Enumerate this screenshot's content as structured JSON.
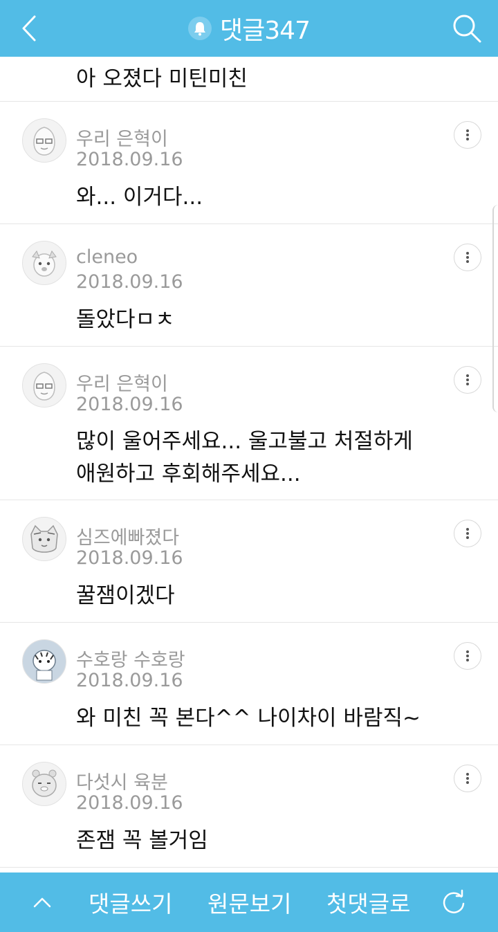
{
  "header": {
    "title": "댓글347",
    "back_icon": "chevron-left-icon",
    "bell_icon": "bell-icon",
    "search_icon": "search-icon"
  },
  "colors": {
    "accent": "#52bce6",
    "meta_text": "#9a9a9a",
    "body_text": "#111111"
  },
  "first_comment_tail": "아 오졌다 미틴미친",
  "comments": [
    {
      "author": "우리 은혁이",
      "date": "2018.09.16",
      "lines": [
        "와... 이거다..."
      ]
    },
    {
      "author": "cleneo",
      "date": "2018.09.16",
      "lines": [
        "돌았다ㅁㅊ"
      ]
    },
    {
      "author": "우리 은혁이",
      "date": "2018.09.16",
      "lines": [
        "많이 울어주세요... 울고불고 처절하게",
        "애원하고 후회해주세요..."
      ]
    },
    {
      "author": "심즈에빠졌다",
      "date": "2018.09.16",
      "lines": [
        "꿀잼이겠다"
      ]
    },
    {
      "author": "수호랑 수호랑",
      "date": "2018.09.16",
      "lines": [
        "와 미친 꼭 본다^^ 나이차이 바람직~"
      ]
    },
    {
      "author": "다섯시 육분",
      "date": "2018.09.16",
      "lines": [
        "존잼 꼭 볼거임"
      ]
    }
  ],
  "bottom_bar": {
    "up_icon": "chevron-up-icon",
    "write": "댓글쓰기",
    "original": "원문보기",
    "first_comment": "첫댓글로",
    "refresh_icon": "refresh-icon"
  }
}
